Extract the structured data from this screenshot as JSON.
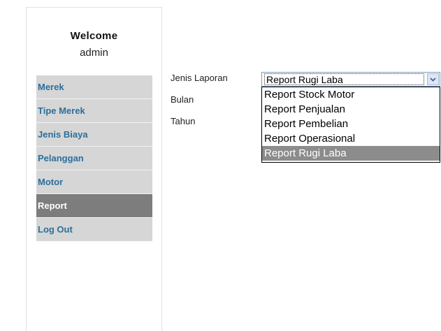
{
  "sidebar": {
    "welcome_title": "Welcome",
    "username": "admin",
    "menu": [
      {
        "label": "Merek",
        "active": false
      },
      {
        "label": "Tipe Merek",
        "active": false
      },
      {
        "label": "Jenis Biaya",
        "active": false
      },
      {
        "label": "Pelanggan",
        "active": false
      },
      {
        "label": "Motor",
        "active": false
      },
      {
        "label": "Report",
        "active": true
      },
      {
        "label": "Log Out",
        "active": false
      }
    ]
  },
  "form": {
    "jenis_laporan_label": "Jenis Laporan",
    "bulan_label": "Bulan",
    "tahun_label": "Tahun",
    "jenis_laporan_value": "Report Rugi Laba",
    "jenis_laporan_options": [
      "Report Stock Motor",
      "Report Penjualan",
      "Report Pembelian",
      "Report Operasional",
      "Report Rugi Laba"
    ],
    "selected_index": 4
  },
  "icons": {
    "dropdown_arrow": "chevron-down-icon"
  },
  "colors": {
    "menu_bg": "#d6d6d6",
    "menu_text": "#2a6f9c",
    "menu_active_bg": "#7d7d7d",
    "option_selected_bg": "#8c8c8c"
  }
}
